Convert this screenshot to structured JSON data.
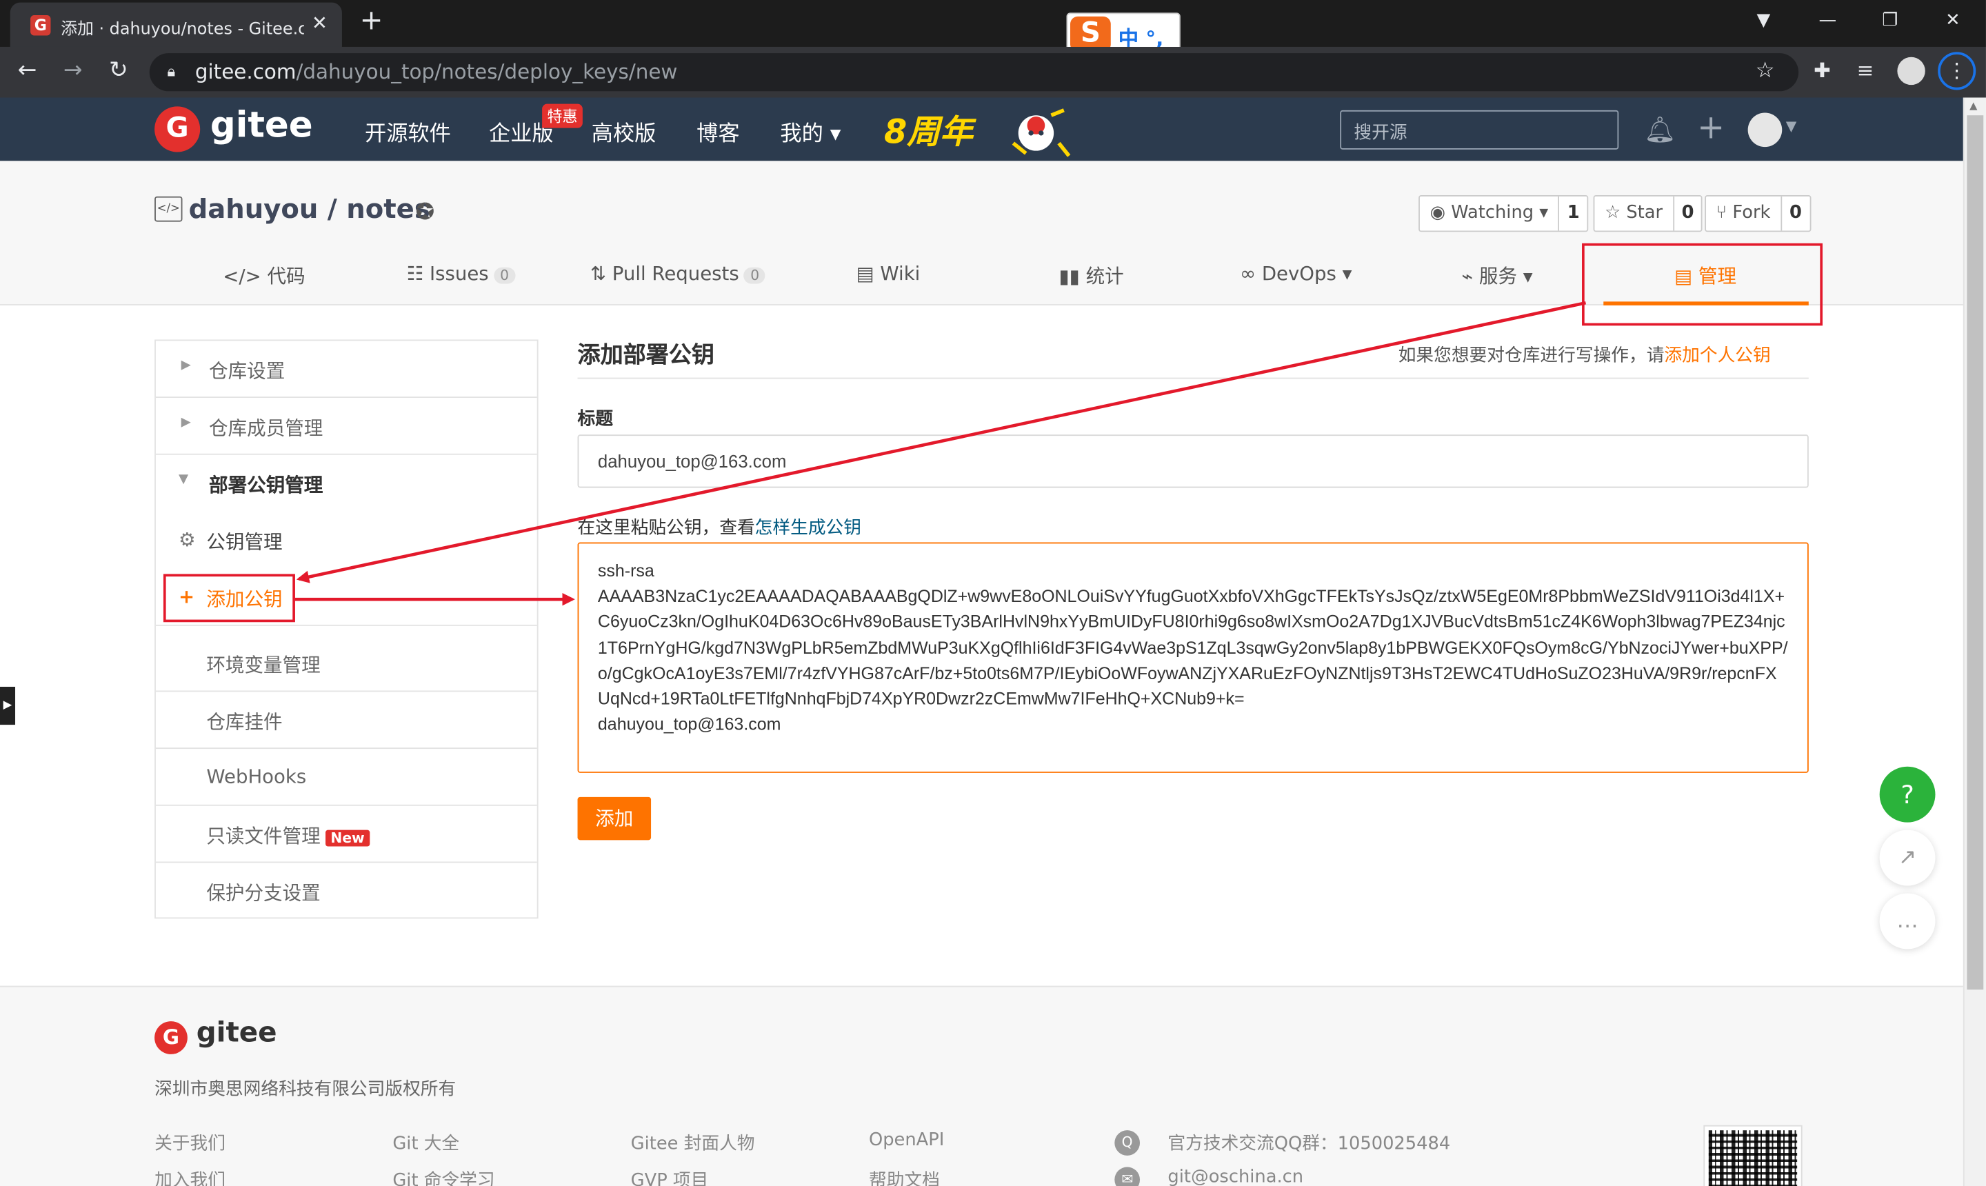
{
  "browser": {
    "tab_title": "添加 · dahuyou/notes - Gitee.com",
    "favicon": "G",
    "url_host": "gitee.com",
    "url_path": "/dahuyou_top/notes/deploy_keys/new",
    "ime_logo": "S",
    "ime_text": "中 °,"
  },
  "header": {
    "brand": "gitee",
    "nav": [
      "开源软件",
      "企业版",
      "高校版",
      "博客",
      "我的"
    ],
    "enterprise_badge": "特惠",
    "my_caret": "▾",
    "anniversary": "8周年",
    "search_placeholder": "搜开源"
  },
  "repo": {
    "name": "dahuyou / notes",
    "watching_label": "Watching ▾",
    "watching_count": "1",
    "star_label": "Star",
    "star_count": "0",
    "fork_label": "Fork",
    "fork_count": "0",
    "tabs": [
      {
        "label": "代码",
        "count": ""
      },
      {
        "label": "Issues",
        "count": "0"
      },
      {
        "label": "Pull Requests",
        "count": "0"
      },
      {
        "label": "Wiki",
        "count": ""
      },
      {
        "label": "统计",
        "count": ""
      },
      {
        "label": "DevOps ▾",
        "count": ""
      },
      {
        "label": "服务 ▾",
        "count": ""
      },
      {
        "label": "管理",
        "count": ""
      }
    ],
    "active_tab": "管理"
  },
  "sidebar": {
    "items": [
      {
        "label": "仓库设置"
      },
      {
        "label": "仓库成员管理"
      },
      {
        "label": "部署公钥管理"
      }
    ],
    "subitems": [
      {
        "label": "公钥管理"
      },
      {
        "label": "添加公钥"
      }
    ],
    "more": [
      {
        "label": "环境变量管理"
      },
      {
        "label": "仓库挂件"
      },
      {
        "label": "WebHooks"
      },
      {
        "label": "只读文件管理"
      },
      {
        "label": "保护分支设置"
      }
    ],
    "new_badge": "New"
  },
  "main": {
    "title": "添加部署公钥",
    "hint_prefix": "如果您想要对仓库进行写操作，请",
    "hint_link": "添加个人公钥",
    "title_label": "标题",
    "title_value": "dahuyou_top@163.com",
    "key_hint_prefix": "在这里粘贴公钥，查看",
    "key_hint_link": "怎样生成公钥",
    "key_value": "ssh-rsa\nAAAAB3NzaC1yc2EAAAADAQABAAABgQDlZ+w9wvE8oONLOuiSvYYfugGuotXxbfoVXhGgcTFEkTsYsJsQz/ztxW5EgE0Mr8PbbmWeZSIdV911Oi3d4l1X+C6yuoCz3kn/OgIhuK04D63Oc6Hv89oBausETy3BArlHvlN9hxYyBmUIDyFU8I0rhi9g6so8wIXsmOo2A7Dg1XJVBucVdtsBm51cZ4K6Woph3lbwag7PEZ34njc1T6PrnYgHG/kgd7N3WgPLbR5emZbdMWuP3uKXgQflhIi6IdF3FIG4vWae3pS1ZqL3sqwGy2onv5lap8y1bPBWGEKX0FQsOym8cG/YbNzociJYwer+buXPP/o/gCgkOcA1oyE3s7EMl/7r4zfVYHG87cArF/bz+5to0ts6M7P/IEybiOoWFoywANZjYXARuEzFOyNZNtljs9T3HsT2EWC4TUdHoSuZO23HuVA/9R9r/repcnFXUqNcd+19RTa0LtFETlfgNnhqFbjD74XpYR0Dwzr2zCEmwMw7IFeHhQ+XCNub9+k=\ndahuyou_top@163.com",
    "submit_label": "添加"
  },
  "footer": {
    "brand": "gitee",
    "copyright": "深圳市奥思网络科技有限公司版权所有",
    "links_col1": [
      "关于我们",
      "加入我们"
    ],
    "links_col2": [
      "Git 大全",
      "Git 命令学习"
    ],
    "links_col3": [
      "Gitee 封面人物",
      "GVP 项目"
    ],
    "links_col4": [
      "OpenAPI",
      "帮助文档"
    ],
    "qq_group": "官方技术交流QQ群：1050025484",
    "email": "git@oschina.cn"
  },
  "colors": {
    "accent": "#fe7300",
    "header_bg": "#2c3b4e",
    "annotation": "#e3192b",
    "help_green": "#2bb33b"
  },
  "icons": {
    "help": "?",
    "share": "↗",
    "chat": "…"
  }
}
